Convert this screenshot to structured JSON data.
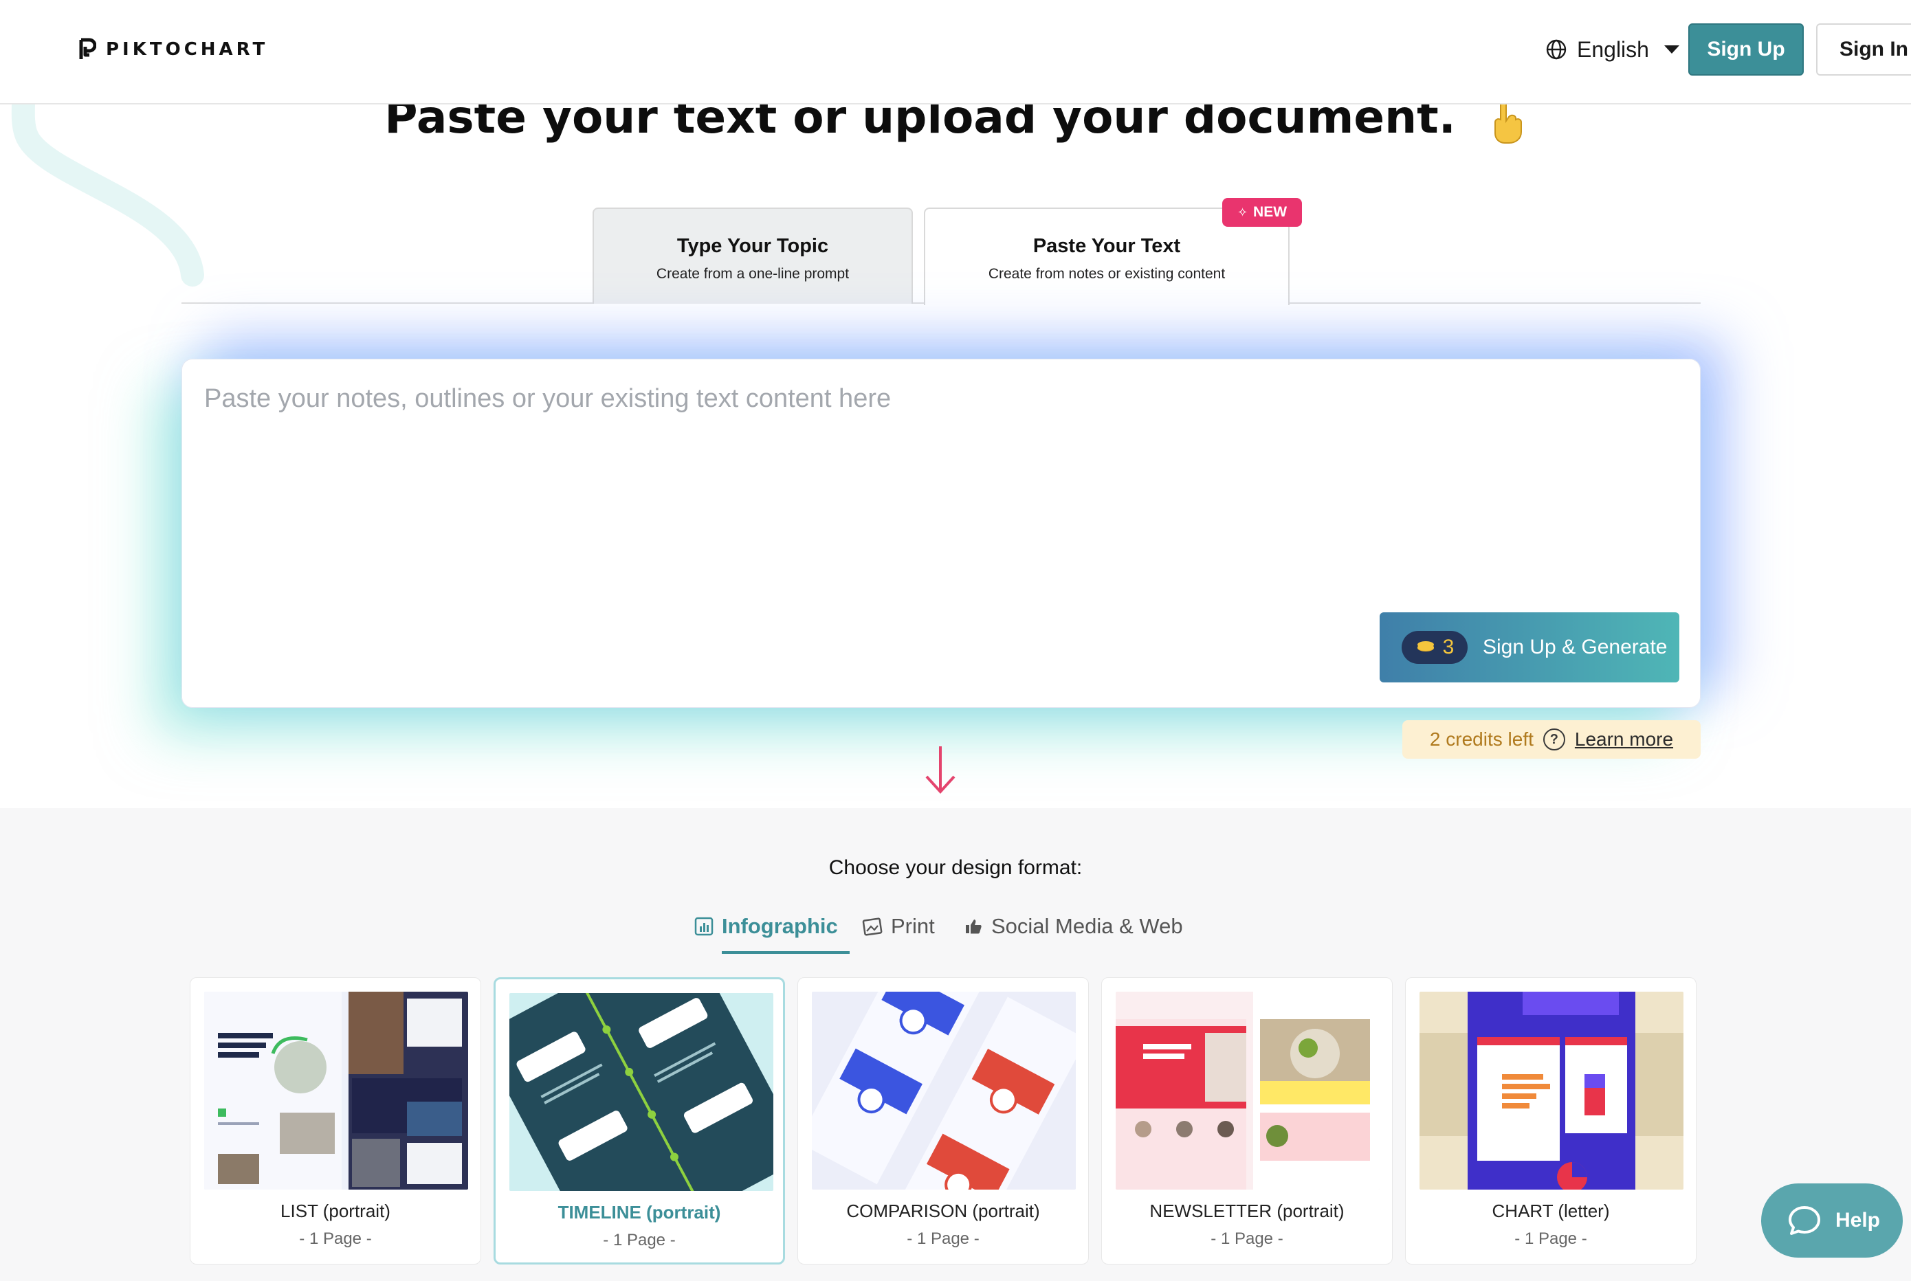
{
  "header": {
    "logo_text": "PIKTOCHART",
    "language": "English",
    "signup_label": "Sign Up",
    "signin_label": "Sign In"
  },
  "hero": {
    "title": "Paste your text or upload your document."
  },
  "tabs": [
    {
      "title": "Type Your Topic",
      "subtitle": "Create from a one-line prompt"
    },
    {
      "title": "Paste Your Text",
      "subtitle": "Create from notes or existing content"
    }
  ],
  "new_badge": "NEW",
  "input": {
    "placeholder": "Paste your notes, outlines or your existing text content here",
    "value": ""
  },
  "generate": {
    "credit_cost": "3",
    "label": "Sign Up & Generate"
  },
  "credits": {
    "text": "2 credits left",
    "learn_more": "Learn more"
  },
  "format": {
    "heading": "Choose your design format:",
    "tabs": [
      "Infographic",
      "Print",
      "Social Media & Web"
    ],
    "selected_tab": "Infographic"
  },
  "cards": [
    {
      "label": "LIST (portrait)",
      "pages": "- 1 Page -"
    },
    {
      "label": "TIMELINE (portrait)",
      "pages": "- 1 Page -"
    },
    {
      "label": "COMPARISON (portrait)",
      "pages": "- 1 Page -"
    },
    {
      "label": "NEWSLETTER (portrait)",
      "pages": "- 1 Page -"
    },
    {
      "label": "CHART (letter)",
      "pages": "- 1 Page -"
    }
  ],
  "help_label": "Help",
  "colors": {
    "accent": "#3c8f98",
    "badge": "#e9346e",
    "credits_bg": "#fdf0d2",
    "credits_text": "#b07a1e"
  },
  "icons": [
    "globe-icon",
    "caret-down-icon",
    "pointing-down-icon",
    "sparkle-icon",
    "coin-icon",
    "question-icon",
    "arrow-down-icon",
    "bar-chart-icon",
    "image-icon",
    "thumbs-up-icon",
    "chat-icon"
  ]
}
